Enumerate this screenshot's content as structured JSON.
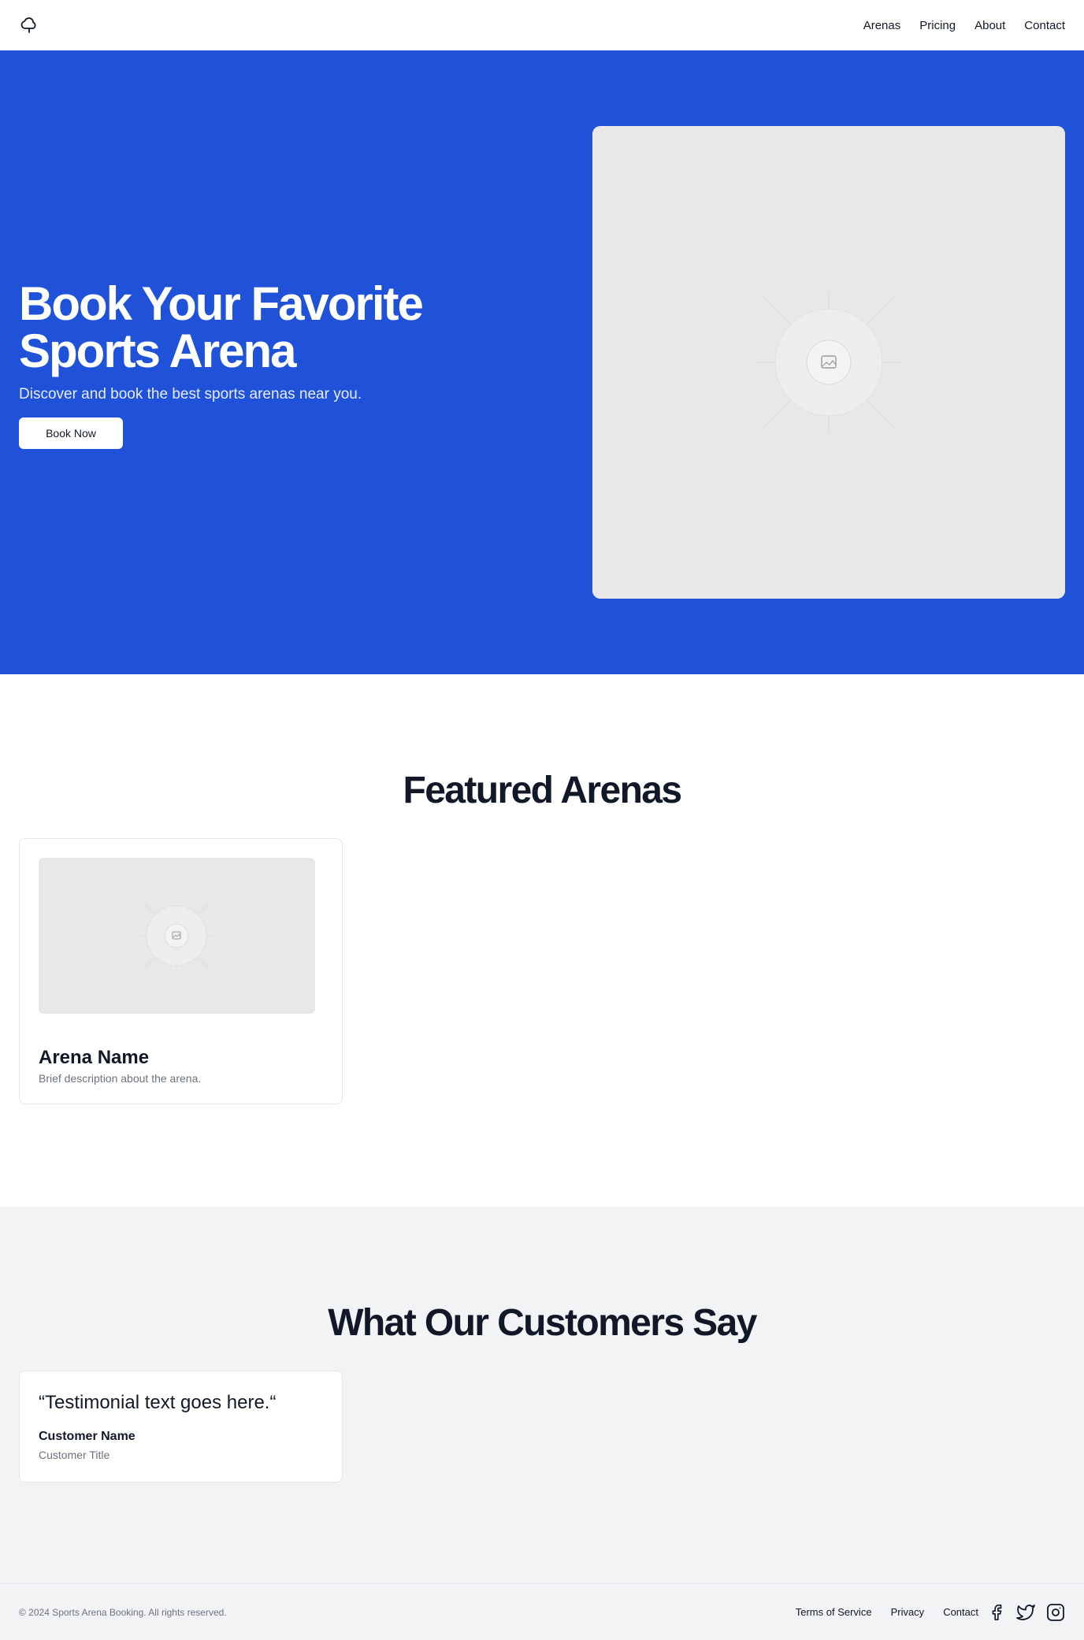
{
  "nav": {
    "logo_icon": "cloud-icon",
    "links": [
      "Arenas",
      "Pricing",
      "About",
      "Contact"
    ]
  },
  "hero": {
    "title_line1": "Book Your Favorite",
    "title_line2": "Sports Arena",
    "subtitle": "Discover and book the best sports arenas near you.",
    "cta_label": "Book Now",
    "image_icon": "image-placeholder-icon"
  },
  "featured": {
    "heading": "Featured Arenas",
    "card": {
      "name": "Arena Name",
      "description": "Brief description about the arena.",
      "image_icon": "image-placeholder-icon"
    }
  },
  "testimonials": {
    "heading": "What Our Customers Say",
    "card": {
      "quote": "“Testimonial text goes here.“",
      "name": "Customer Name",
      "title": "Customer Title"
    }
  },
  "footer": {
    "copyright": "© 2024 Sports Arena Booking. All rights reserved.",
    "links": [
      "Terms of Service",
      "Privacy",
      "Contact"
    ],
    "social_icons": [
      "facebook-icon",
      "twitter-icon",
      "instagram-icon"
    ]
  },
  "colors": {
    "primary": "#1f51d9",
    "placeholder_bg": "#e8e8e8",
    "section_alt_bg": "#f2f3f5",
    "text_dark": "#111827",
    "text_muted": "#6b7280"
  }
}
